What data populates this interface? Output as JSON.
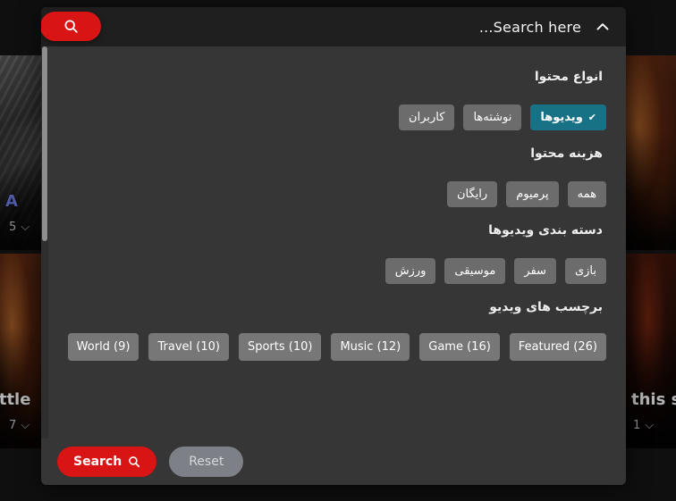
{
  "modal": {
    "header": {
      "toggle_label": "...Search here",
      "chevron_icon": "chevron-up-icon",
      "search_pill_icon": "search-icon"
    },
    "groups": [
      {
        "id": "content-types",
        "title": "انواع محتوا",
        "chips": [
          {
            "label": "ویدیوها",
            "selected": true,
            "check": "✔"
          },
          {
            "label": "نوشته‌ها",
            "selected": false
          },
          {
            "label": "کاربران",
            "selected": false
          }
        ]
      },
      {
        "id": "content-cost",
        "title": "هزینه محتوا",
        "chips": [
          {
            "label": "همه",
            "selected": false
          },
          {
            "label": "پرمیوم",
            "selected": false
          },
          {
            "label": "رایگان",
            "selected": false
          }
        ]
      },
      {
        "id": "video-categories",
        "title": "دسته بندی ویدیوها",
        "chips": [
          {
            "label": "بازی",
            "selected": false
          },
          {
            "label": "سفر",
            "selected": false
          },
          {
            "label": "موسیقی",
            "selected": false
          },
          {
            "label": "ورزش",
            "selected": false
          }
        ]
      },
      {
        "id": "video-tags",
        "title": "برچسب های ویدیو",
        "chips": [
          {
            "label": "Featured (26)",
            "selected": false
          },
          {
            "label": "Game (16)",
            "selected": false
          },
          {
            "label": "Music (12)",
            "selected": false
          },
          {
            "label": "Sports (10)",
            "selected": false
          },
          {
            "label": "Travel (10)",
            "selected": false
          },
          {
            "label": "World (9)",
            "selected": false
          }
        ]
      }
    ],
    "footer": {
      "search_label": "Search",
      "search_icon": "search-icon",
      "reset_label": "Reset"
    }
  },
  "background": {
    "cards": [
      {
        "id": "a",
        "title": "A",
        "comments": "5",
        "comment_icon": "comment-icon"
      },
      {
        "id": "b",
        "title": "s Battle",
        "comments": "7",
        "comment_icon": "comment-icon"
      },
      {
        "id": "c",
        "title": "",
        "comments": "",
        "comment_icon": "comment-icon"
      },
      {
        "id": "d",
        "title": "this s",
        "comments": "1",
        "comment_icon": "comment-icon"
      }
    ]
  },
  "colors": {
    "accent_red": "#d81414",
    "selected_teal": "#177286",
    "chip_gray": "#6c6c6c",
    "panel_bg": "#363636",
    "header_bg": "#1f1f1f"
  }
}
